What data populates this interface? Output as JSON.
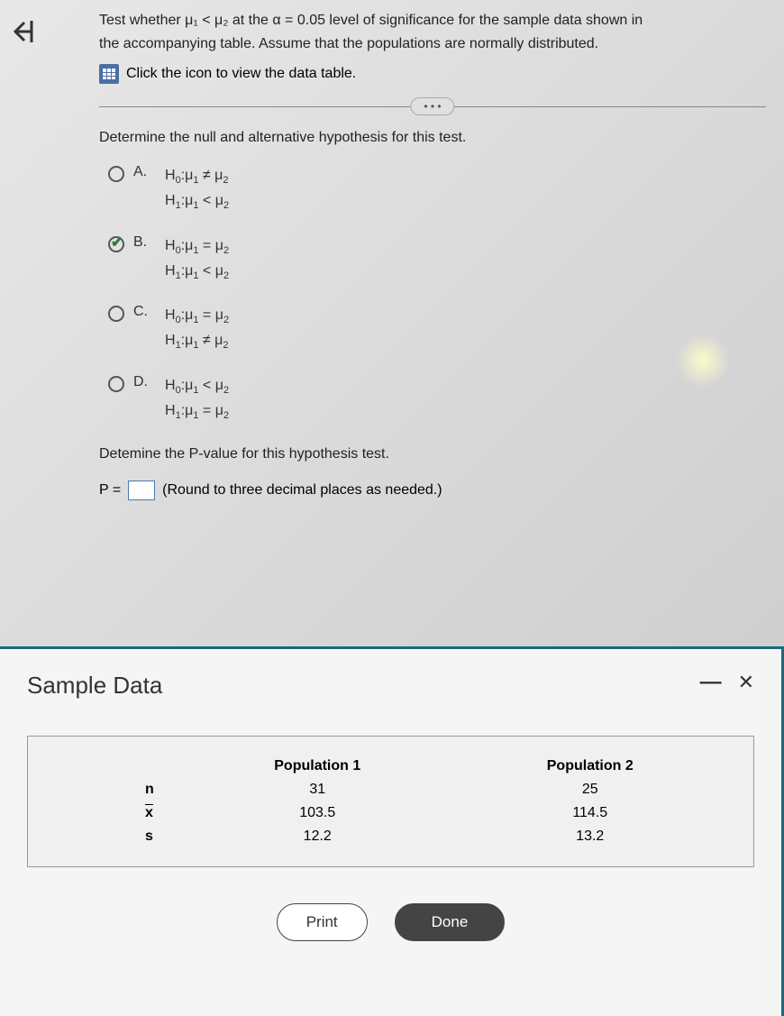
{
  "question": {
    "text_line1": "Test whether μ₁ < μ₂ at the α = 0.05 level of significance for the sample data shown in",
    "text_line2": "the accompanying table. Assume that the populations are normally distributed.",
    "link_text": "Click the icon to view the data table."
  },
  "sub_question": "Determine the null and alternative hypothesis for this test.",
  "options": {
    "A": {
      "label": "A.",
      "h0": "H₀:μ₁ ≠ μ₂",
      "h1": "H₁:μ₁ < μ₂",
      "selected": false
    },
    "B": {
      "label": "B.",
      "h0": "H₀:μ₁ = μ₂",
      "h1": "H₁:μ₁ < μ₂",
      "selected": true
    },
    "C": {
      "label": "C.",
      "h0": "H₀:μ₁ = μ₂",
      "h1": "H₁:μ₁ ≠ μ₂",
      "selected": false
    },
    "D": {
      "label": "D.",
      "h0": "H₀:μ₁ < μ₂",
      "h1": "H₁:μ₁ = μ₂",
      "selected": false
    }
  },
  "pvalue": {
    "prompt": "Detemine the P-value for this hypothesis test.",
    "prefix": "P =",
    "suffix": "(Round to three decimal places as needed.)"
  },
  "modal": {
    "title": "Sample Data",
    "headers": {
      "col1": "",
      "col2": "Population 1",
      "col3": "Population 2"
    },
    "rows": {
      "n": {
        "label": "n",
        "pop1": "31",
        "pop2": "25"
      },
      "xbar": {
        "label": "x̄",
        "pop1": "103.5",
        "pop2": "114.5"
      },
      "s": {
        "label": "s",
        "pop1": "12.2",
        "pop2": "13.2"
      }
    },
    "buttons": {
      "print": "Print",
      "done": "Done"
    }
  }
}
